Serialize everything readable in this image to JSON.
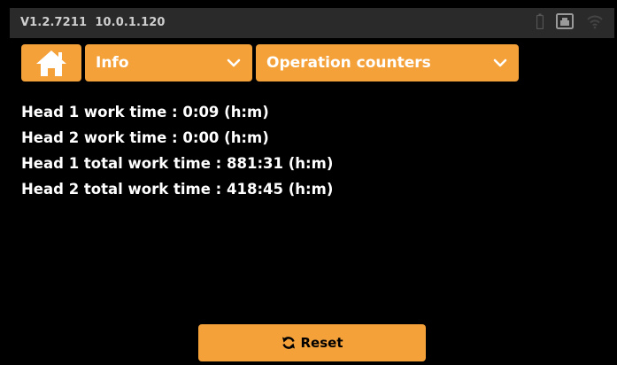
{
  "status_bar": {
    "version": "V1.2.7211",
    "ip": "10.0.1.120",
    "icons": [
      "battery-icon",
      "network-icon",
      "wifi-icon"
    ]
  },
  "nav": {
    "home_icon": "home-icon",
    "menu_selected": "Info",
    "submenu_selected": "Operation counters"
  },
  "counters": [
    "Head 1 work time : 0:09 (h:m)",
    "Head 2 work time : 0:00 (h:m)",
    "Head 1 total work time : 881:31 (h:m)",
    "Head 2 total work time : 418:45 (h:m)"
  ],
  "actions": {
    "reset_label": "Reset",
    "reset_icon": "refresh-icon"
  },
  "colors": {
    "accent": "#f4a13a",
    "background": "#000000",
    "status_bar": "#2a2a2a"
  }
}
